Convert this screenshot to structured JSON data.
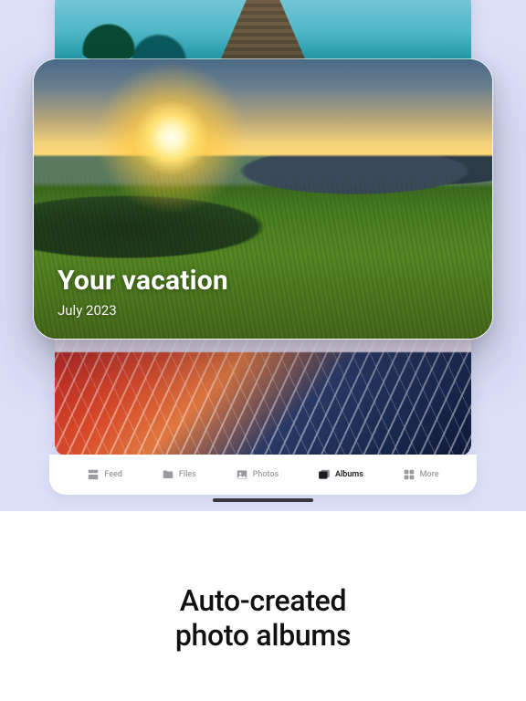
{
  "feature_card": {
    "title": "Your vacation",
    "subtitle": "July 2023"
  },
  "tabs": [
    {
      "label": "Feed"
    },
    {
      "label": "Files"
    },
    {
      "label": "Photos"
    },
    {
      "label": "Albums"
    },
    {
      "label": "More"
    }
  ],
  "active_tab_index": 3,
  "tagline_line1": "Auto-created",
  "tagline_line2": "photo albums"
}
